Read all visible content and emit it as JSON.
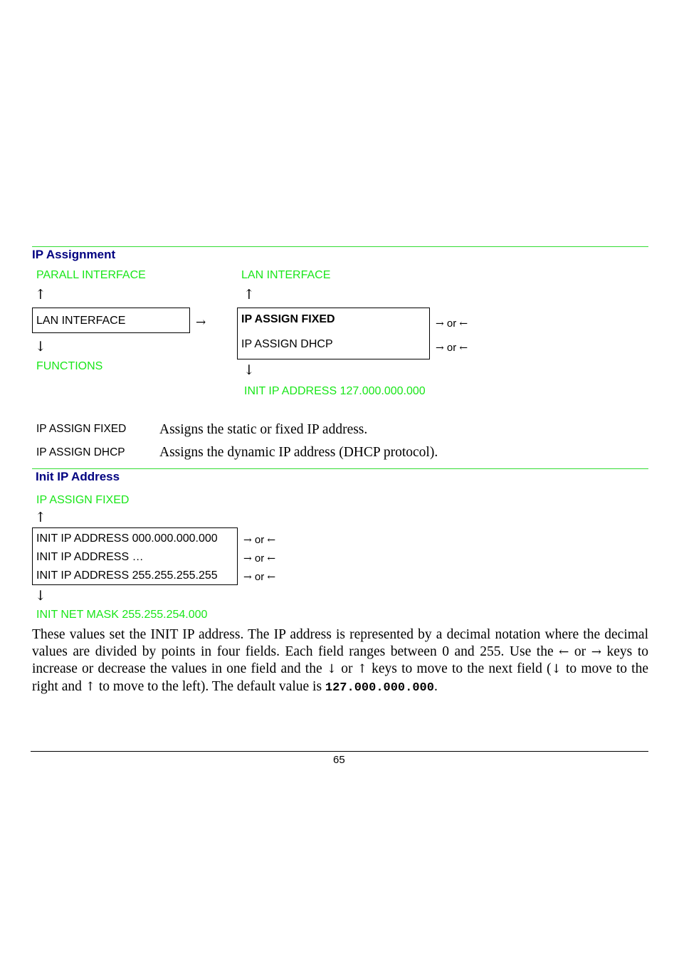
{
  "section1": {
    "title": "IP Assignment",
    "left_col": {
      "prev_item": "PARALL INTERFACE",
      "up_arrow": "↑",
      "current_item": "LAN INTERFACE",
      "down_arrow": "↓",
      "next_item": "FUNCTIONS"
    },
    "enter_arrow": "→",
    "right_col": {
      "prev_item": "LAN INTERFACE",
      "up_arrow": "↑",
      "options": [
        {
          "label": "IP ASSIGN FIXED",
          "bold": true,
          "nav": {
            "right": "→",
            "or": "or",
            "left": "←"
          }
        },
        {
          "label": "IP ASSIGN DHCP",
          "bold": false,
          "nav": {
            "right": "→",
            "or": "or",
            "left": "←"
          }
        }
      ],
      "down_arrow": "↓",
      "next_item": "INIT IP ADDRESS 127.000.000.000"
    },
    "definitions": [
      {
        "term": "IP ASSIGN FIXED",
        "description": "Assigns the static or fixed IP address."
      },
      {
        "term": "IP ASSIGN DHCP",
        "description": "Assigns the dynamic IP address (DHCP protocol)."
      }
    ]
  },
  "section2": {
    "title": "Init IP Address",
    "prev_item": "IP ASSIGN FIXED",
    "up_arrow": "↑",
    "options": [
      {
        "label": "INIT IP ADDRESS 000.000.000.000",
        "nav": {
          "right": "→",
          "or": "or",
          "left": "←"
        }
      },
      {
        "label": "INIT IP ADDRESS …",
        "nav": {
          "right": "→",
          "or": "or",
          "left": "←"
        }
      },
      {
        "label": "INIT IP ADDRESS 255.255.255.255",
        "nav": {
          "right": "→",
          "or": "or",
          "left": "←"
        }
      }
    ],
    "down_arrow": "↓",
    "next_item": "INIT NET MASK 255.255.254.000",
    "paragraph": {
      "p1": "These values set the INIT IP address. The IP address is represented by a decimal notation where the decimal values are divided by points in four fields. Each field ranges between 0 and 255. Use the ",
      "a1": "←",
      "p2": " or ",
      "a2": "→",
      "p3": " keys to increase or decrease the values in one field and the ",
      "a3": "↓",
      "p4": " or ",
      "a4": "↑",
      "p5": " keys to move to the next field (",
      "a5": "↓",
      "p6": " to move to the right and ",
      "a6": "↑",
      "p7": " to move to the left). The default value is ",
      "default_value": "127.000.000.000",
      "p8": "."
    }
  },
  "footer": {
    "page_number": "65"
  }
}
